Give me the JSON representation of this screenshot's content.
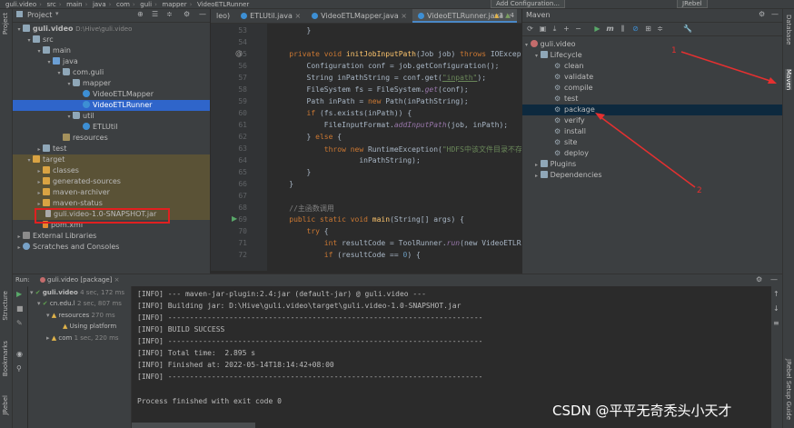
{
  "breadcrumb": [
    "guli.video",
    "src",
    "main",
    "java",
    "com",
    "guli",
    "mapper",
    "VideoETLRunner"
  ],
  "top_buttons": {
    "add_configuration": "Add Configuration...",
    "jrebel": "JRebel"
  },
  "left_stripe": {
    "project": "Project",
    "structure": "Structure",
    "bookmarks": "Bookmarks",
    "jrebel": "JRebel"
  },
  "right_stripe": {
    "database": "Database",
    "maven": "Maven",
    "jrebel_setup": "JRebel Setup Guide"
  },
  "project_panel": {
    "title": "Project",
    "tree": [
      {
        "label": "guli.video",
        "hint": "D:\\Hive\\guli.video"
      },
      {
        "label": "src"
      },
      {
        "label": "main"
      },
      {
        "label": "java"
      },
      {
        "label": "com.guli"
      },
      {
        "label": "mapper"
      },
      {
        "label": "VideoETLMapper"
      },
      {
        "label": "VideoETLRunner"
      },
      {
        "label": "util"
      },
      {
        "label": "ETLUtil"
      },
      {
        "label": "resources"
      },
      {
        "label": "test"
      },
      {
        "label": "target"
      },
      {
        "label": "classes"
      },
      {
        "label": "generated-sources"
      },
      {
        "label": "maven-archiver"
      },
      {
        "label": "maven-status"
      },
      {
        "label": "guli.video-1.0-SNAPSHOT.jar"
      },
      {
        "label": "pom.xml"
      },
      {
        "label": "External Libraries"
      },
      {
        "label": "Scratches and Consoles"
      }
    ]
  },
  "editor": {
    "tabs": [
      {
        "label": "leo)"
      },
      {
        "label": "ETLUtil.java"
      },
      {
        "label": "VideoETLMapper.java"
      },
      {
        "label": "VideoETLRunner.java"
      }
    ],
    "inspection": {
      "warnings": "3",
      "weak": "4"
    },
    "line_numbers": [
      "53",
      "54",
      "55",
      "56",
      "57",
      "58",
      "59",
      "60",
      "61",
      "62",
      "63",
      "64",
      "65",
      "66",
      "67",
      "68",
      "69",
      "70",
      "71",
      "72"
    ],
    "code": {
      "l53": "        }",
      "l55_a": "    private void ",
      "l55_fn": "initJobInputPath",
      "l55_b": "(Job job) ",
      "l55_kw": "throws",
      "l55_c": " IOException {",
      "l56": "        Configuration conf = job.getConfiguration();",
      "l57_a": "        String inPathString = conf.get(",
      "l57_st": "\"inpath\"",
      "l57_b": ");",
      "l58_a": "        FileSystem fs = FileSystem.",
      "l58_it": "get",
      "l58_b": "(conf);",
      "l59_a": "        Path inPath = ",
      "l59_kw": "new",
      "l59_b": " Path(inPathString);",
      "l60_kw": "        if",
      "l60_b": " (fs.exists(inPath)) {",
      "l61_a": "            FileInputFormat.",
      "l61_it": "addInputPath",
      "l61_b": "(job, inPath);",
      "l62_a": "        } ",
      "l62_kw": "else",
      "l62_b": " {",
      "l63_kw": "            throw new",
      "l63_b": " RuntimeException(",
      "l63_st": "\"HDFS中该文件目录不存在: \"",
      "l64": "                    inPathString);",
      "l65": "        }",
      "l66": "    }",
      "l68": "    //主函数调用",
      "l69_kw": "    public static void",
      "l69_fn": " main",
      "l69_b": "(String[] args) {",
      "l70_kw": "        try",
      "l70_b": " {",
      "l71_kw": "            int",
      "l71_a": " resultCode = ToolRunner.",
      "l71_it": "run",
      "l71_b": "(new VideoETLRunner",
      "l72_kw": "            if",
      "l72_a": " (resultCode == ",
      "l72_num": "0",
      "l72_b": ") {"
    }
  },
  "maven_panel": {
    "title": "Maven",
    "project": "guli.video",
    "lifecycle": "Lifecycle",
    "goals": [
      "clean",
      "validate",
      "compile",
      "test",
      "package",
      "verify",
      "install",
      "site",
      "deploy"
    ],
    "plugins": "Plugins",
    "dependencies": "Dependencies"
  },
  "annotations": {
    "one": "1",
    "two": "2"
  },
  "run_panel": {
    "label": "Run:",
    "tab": "guli.video [package]",
    "tree": [
      {
        "label": "guli.video",
        "time": "4 sec, 172 ms"
      },
      {
        "label": "cn.edu.l",
        "time": "2 sec, 807 ms"
      },
      {
        "label": "resources",
        "time": "270 ms"
      },
      {
        "label": "Using platform"
      },
      {
        "label": "com",
        "time": "1 sec, 220 ms"
      }
    ],
    "console": [
      "[INFO] --- maven-jar-plugin:2.4:jar (default-jar) @ guli.video ---",
      "[INFO] Building jar: D:\\Hive\\guli.video\\target\\guli.video-1.0-SNAPSHOT.jar",
      "[INFO] ------------------------------------------------------------------------",
      "[INFO] BUILD SUCCESS",
      "[INFO] ------------------------------------------------------------------------",
      "[INFO] Total time:  2.895 s",
      "[INFO] Finished at: 2022-05-14T18:14:42+08:00",
      "[INFO] ------------------------------------------------------------------------",
      "",
      "Process finished with exit code 0"
    ]
  },
  "watermark": "CSDN @平平无奇秃头小天才"
}
